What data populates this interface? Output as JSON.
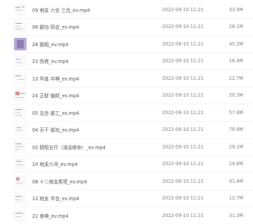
{
  "files": [
    {
      "name": "09 地支 六合 三合_ev.mp4",
      "date": "2022-09-10 11:21",
      "size": "33.9M",
      "thumb_icon": "video-frame-thumbnail"
    },
    {
      "name": "06 部功 四合_ev.mp4",
      "date": "2022-09-10 11:21",
      "size": "28.1M",
      "thumb_icon": "video-frame-thumbnail"
    },
    {
      "name": "28 面相_ev.mp4",
      "date": "2022-09-10 11:21",
      "size": "45.2M",
      "thumb_icon": "purple-video-thumbnail"
    },
    {
      "name": "23 伤官_ev.mp4",
      "date": "2022-09-10 11:21",
      "size": "18.4M",
      "thumb_icon": "video-frame-thumbnail"
    },
    {
      "name": "13 华盖 中神_ev.mp4",
      "date": "2022-09-10 11:21",
      "size": "22.7M",
      "thumb_icon": "video-frame-thumbnail"
    },
    {
      "name": "24 正财 偏财_ev.mp4",
      "date": "2022-09-10 11:21",
      "size": "29.3M",
      "thumb_icon": "video-frame-thumbnail"
    },
    {
      "name": "05 五合 部工_ev.mp4",
      "date": "2022-09-10 11:21",
      "size": "57.8M",
      "thumb_icon": "video-frame-thumbnail"
    },
    {
      "name": "04 天干 部功_ev.mp4",
      "date": "2022-09-10 11:21",
      "size": "76.8M",
      "thumb_icon": "video-frame-thumbnail"
    },
    {
      "name": "02 阴阳五行（浅谈夜命）_ev.mp4",
      "date": "2022-09-10 11:21",
      "size": "29.1M",
      "thumb_icon": "video-frame-thumbnail"
    },
    {
      "name": "10 地支六冲_ev.mp4",
      "date": "2022-09-10 11:21",
      "size": "24.6M",
      "thumb_icon": "video-frame-thumbnail"
    },
    {
      "name": "08 十二地支类项_ev.mp4",
      "date": "2022-09-10 11:21",
      "size": "41.4M",
      "thumb_icon": "video-frame-thumbnail"
    },
    {
      "name": "12 地支 半合_ev.mp4",
      "date": "2022-09-10 11:21",
      "size": "12.7M",
      "thumb_icon": "video-frame-thumbnail"
    },
    {
      "name": "22 食神_ev.mp4",
      "date": "2022-09-10 11:21",
      "size": "31.3M",
      "thumb_icon": "video-frame-thumbnail"
    }
  ],
  "colors": {
    "name_text": "#4a4a4a",
    "meta_text": "#7a7a7a",
    "divider": "#f2f2f2",
    "purple_thumb": "#b9a9d6"
  }
}
